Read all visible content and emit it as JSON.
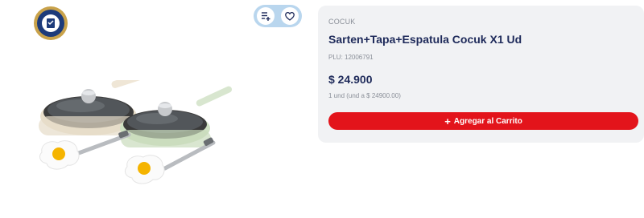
{
  "badge": {
    "icon": "certification-seal-icon",
    "color": "#c9a24a"
  },
  "actions": {
    "list_icon": "add-to-list-icon",
    "favorite_icon": "heart-icon",
    "pill_color": "#b9d6ee"
  },
  "product_image": {
    "icon": "cookware-set-image"
  },
  "product": {
    "brand": "COCUK",
    "title": "Sarten+Tapa+Espatula Cocuk X1 Ud",
    "plu": "PLU: 12006791",
    "price": "$ 24.900",
    "unit_price": "1 und (und a $ 24900.00)",
    "add_button_plus": "+",
    "add_button_label": "Agregar al Carrito",
    "accent_color": "#e3141b",
    "text_color": "#1e2a5a"
  }
}
